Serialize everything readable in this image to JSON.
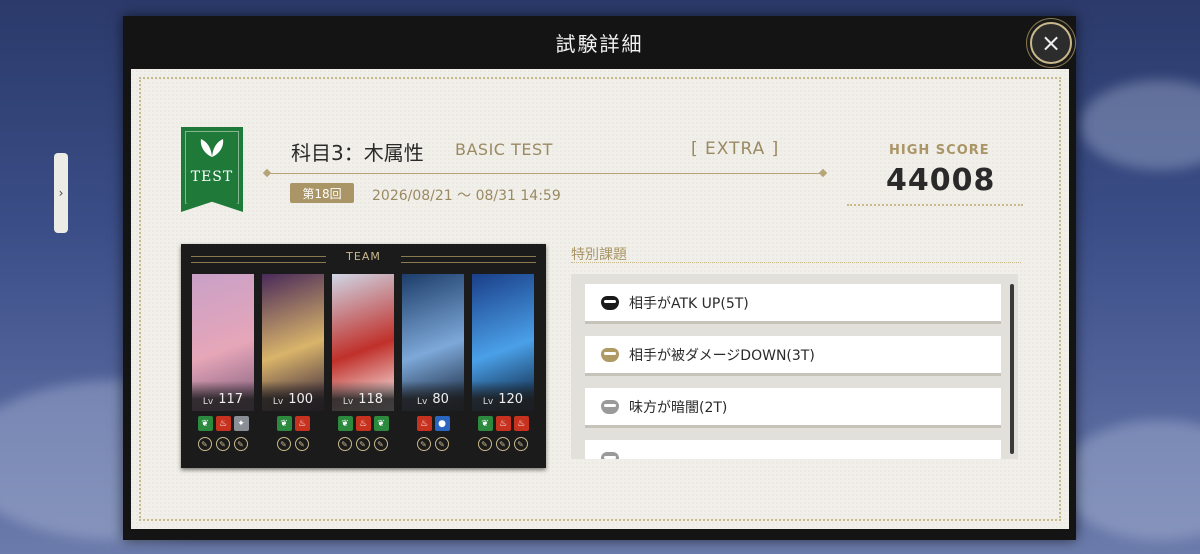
{
  "modal": {
    "title": "試験詳細",
    "close_label": "×"
  },
  "exam": {
    "badge_text": "TEST",
    "subject": "科目3：木属性",
    "subject_en": "BASIC TEST",
    "difficulty": "[  EXTRA  ]",
    "round": "第18回",
    "period": "2026/08/21 〜 08/31 14:59"
  },
  "high_score": {
    "label": "HIGH SCORE",
    "value": "44008"
  },
  "team": {
    "title": "TEAM",
    "level_prefix": "Lv",
    "members": [
      {
        "level": "117",
        "colors": [
          "#c9a0c8",
          "#e6a6b8",
          "#7b5a7a"
        ],
        "elements": [
          "g",
          "r",
          "s"
        ]
      },
      {
        "level": "100",
        "colors": [
          "#4a2a5a",
          "#d9b46a",
          "#2d1a3a"
        ],
        "elements": [
          "g",
          "r"
        ]
      },
      {
        "level": "118",
        "colors": [
          "#cfd6e6",
          "#c0302a",
          "#ffffff"
        ],
        "elements": [
          "g",
          "r",
          "g"
        ]
      },
      {
        "level": "80",
        "colors": [
          "#1d3d6a",
          "#7da8d8",
          "#0d1a2e"
        ],
        "elements": [
          "r",
          "b"
        ]
      },
      {
        "level": "120",
        "colors": [
          "#1a3f88",
          "#4aa0e8",
          "#081830"
        ],
        "elements": [
          "g",
          "r",
          "r"
        ]
      }
    ]
  },
  "special": {
    "label": "特別課題",
    "tasks": [
      {
        "text": "相手がATK UP(5T)",
        "icon": "mask-icon",
        "icon_color": "#1a1a1a"
      },
      {
        "text": "相手が被ダメージDOWN(3T)",
        "icon": "mask-icon",
        "icon_color": "#b09a63"
      },
      {
        "text": "味方が暗闇(2T)",
        "icon": "mask-icon",
        "icon_color": "#9a9a9a"
      },
      {
        "text": "",
        "icon": "mask-icon",
        "icon_color": "#9a9a9a"
      }
    ]
  }
}
